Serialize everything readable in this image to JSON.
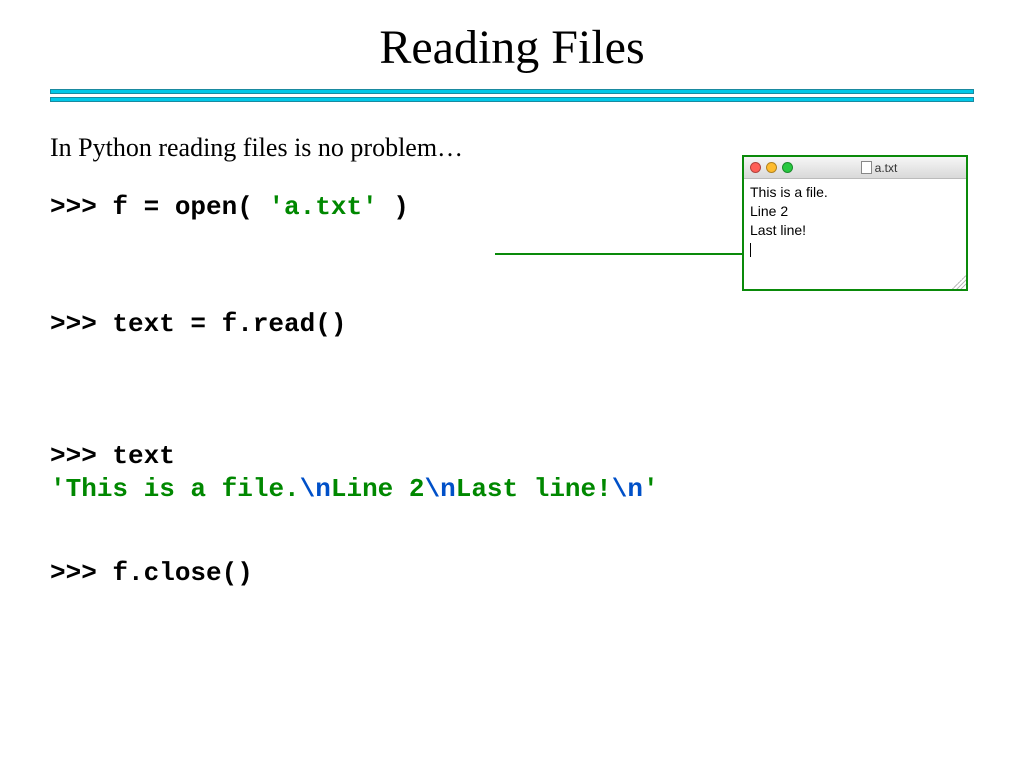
{
  "title": "Reading Files",
  "intro": "In Python reading files is no problem…",
  "code": {
    "open_prefix": ">>> f = open( ",
    "open_arg": "'a.txt'",
    "open_suffix": " )",
    "read": ">>> text = f.read()",
    "echo": ">>> text",
    "result_q1": "'",
    "result_p1": "This is a file.",
    "result_e1": "\\n",
    "result_p2": "Line 2",
    "result_e2": "\\n",
    "result_p3": "Last line!",
    "result_e3": "\\n",
    "result_q2": "'",
    "close": ">>> f.close()"
  },
  "file_window": {
    "filename": "a.txt",
    "line1": "This is a file.",
    "line2": "Line 2",
    "line3": "Last line!"
  },
  "colors": {
    "divider": "#00c8e8",
    "string": "#008800",
    "escape": "#0050c8",
    "window_border": "#0a8a0a"
  }
}
